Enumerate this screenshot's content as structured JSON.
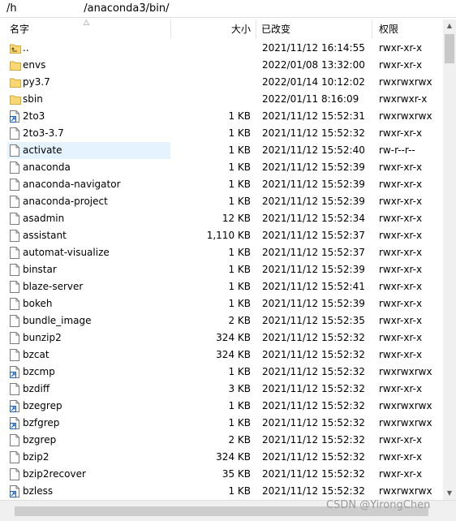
{
  "window": {
    "path": "/h​                    /anaconda3/bin/"
  },
  "columns": {
    "name": "名字",
    "size": "大小",
    "modified": "已改变",
    "permissions": "权限"
  },
  "rows": [
    {
      "name": "..",
      "size": "",
      "date": "2021/11/12 16:14:55",
      "perm": "rwxr-xr-x",
      "icon": "parent-folder-icon"
    },
    {
      "name": "envs",
      "size": "",
      "date": "2022/01/08 13:32:00",
      "perm": "rwxr-xr-x",
      "icon": "folder-icon"
    },
    {
      "name": "py3.7",
      "size": "",
      "date": "2022/01/14 10:12:02",
      "perm": "rwxrwxrwx",
      "icon": "folder-icon"
    },
    {
      "name": "sbin",
      "size": "",
      "date": "2022/01/11 8:16:09",
      "perm": "rwxrwxr-x",
      "icon": "folder-icon"
    },
    {
      "name": "2to3",
      "size": "1 KB",
      "date": "2021/11/12 15:52:31",
      "perm": "rwxrwxrwx",
      "icon": "symlink-icon"
    },
    {
      "name": "2to3-3.7",
      "size": "1 KB",
      "date": "2021/11/12 15:52:32",
      "perm": "rwxr-xr-x",
      "icon": "file-icon"
    },
    {
      "name": "activate",
      "size": "1 KB",
      "date": "2021/11/12 15:52:40",
      "perm": "rw-r--r--",
      "icon": "file-icon",
      "selected": true
    },
    {
      "name": "anaconda",
      "size": "1 KB",
      "date": "2021/11/12 15:52:39",
      "perm": "rwxr-xr-x",
      "icon": "file-icon"
    },
    {
      "name": "anaconda-navigator",
      "size": "1 KB",
      "date": "2021/11/12 15:52:39",
      "perm": "rwxr-xr-x",
      "icon": "file-icon"
    },
    {
      "name": "anaconda-project",
      "size": "1 KB",
      "date": "2021/11/12 15:52:39",
      "perm": "rwxr-xr-x",
      "icon": "file-icon"
    },
    {
      "name": "asadmin",
      "size": "12 KB",
      "date": "2021/11/12 15:52:34",
      "perm": "rwxr-xr-x",
      "icon": "file-icon"
    },
    {
      "name": "assistant",
      "size": "1,110 KB",
      "date": "2021/11/12 15:52:37",
      "perm": "rwxr-xr-x",
      "icon": "file-icon"
    },
    {
      "name": "automat-visualize",
      "size": "1 KB",
      "date": "2021/11/12 15:52:37",
      "perm": "rwxr-xr-x",
      "icon": "file-icon"
    },
    {
      "name": "binstar",
      "size": "1 KB",
      "date": "2021/11/12 15:52:39",
      "perm": "rwxr-xr-x",
      "icon": "file-icon"
    },
    {
      "name": "blaze-server",
      "size": "1 KB",
      "date": "2021/11/12 15:52:41",
      "perm": "rwxr-xr-x",
      "icon": "file-icon"
    },
    {
      "name": "bokeh",
      "size": "1 KB",
      "date": "2021/11/12 15:52:39",
      "perm": "rwxr-xr-x",
      "icon": "file-icon"
    },
    {
      "name": "bundle_image",
      "size": "2 KB",
      "date": "2021/11/12 15:52:35",
      "perm": "rwxr-xr-x",
      "icon": "file-icon"
    },
    {
      "name": "bunzip2",
      "size": "324 KB",
      "date": "2021/11/12 15:52:32",
      "perm": "rwxr-xr-x",
      "icon": "file-icon"
    },
    {
      "name": "bzcat",
      "size": "324 KB",
      "date": "2021/11/12 15:52:32",
      "perm": "rwxr-xr-x",
      "icon": "file-icon"
    },
    {
      "name": "bzcmp",
      "size": "1 KB",
      "date": "2021/11/12 15:52:32",
      "perm": "rwxrwxrwx",
      "icon": "symlink-icon"
    },
    {
      "name": "bzdiff",
      "size": "3 KB",
      "date": "2021/11/12 15:52:32",
      "perm": "rwxr-xr-x",
      "icon": "file-icon"
    },
    {
      "name": "bzegrep",
      "size": "1 KB",
      "date": "2021/11/12 15:52:32",
      "perm": "rwxrwxrwx",
      "icon": "symlink-icon"
    },
    {
      "name": "bzfgrep",
      "size": "1 KB",
      "date": "2021/11/12 15:52:32",
      "perm": "rwxrwxrwx",
      "icon": "symlink-icon"
    },
    {
      "name": "bzgrep",
      "size": "2 KB",
      "date": "2021/11/12 15:52:32",
      "perm": "rwxr-xr-x",
      "icon": "file-icon"
    },
    {
      "name": "bzip2",
      "size": "324 KB",
      "date": "2021/11/12 15:52:32",
      "perm": "rwxr-xr-x",
      "icon": "file-icon"
    },
    {
      "name": "bzip2recover",
      "size": "35 KB",
      "date": "2021/11/12 15:52:32",
      "perm": "rwxr-xr-x",
      "icon": "file-icon"
    },
    {
      "name": "bzless",
      "size": "1 KB",
      "date": "2021/11/12 15:52:32",
      "perm": "rwxrwxrwx",
      "icon": "symlink-icon"
    }
  ],
  "watermark": "CSDN @YirongChen",
  "colors": {
    "folder": "#f8d775",
    "selection": "#e5f3ff",
    "symlink_arrow": "#1a5fb4"
  }
}
